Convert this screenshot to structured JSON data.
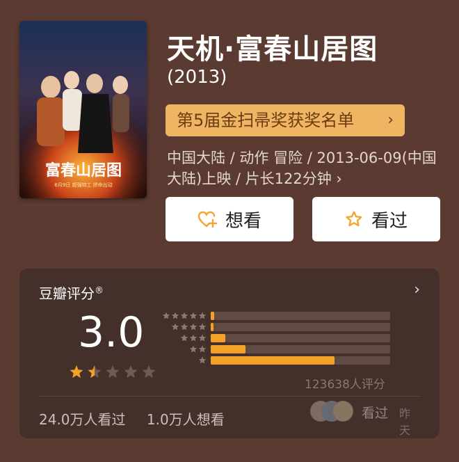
{
  "movie": {
    "title": "天机·富春山居图",
    "year": "(2013)",
    "award": "第5届金扫帚奖获奖名单",
    "meta": "中国大陆 / 动作 冒险 / 2013-06-09(中国大陆)上映 / 片长122分钟 ›",
    "poster": {
      "title": "富春山居图",
      "tagline": "6月9日 超强特工 拼命出动"
    }
  },
  "actions": {
    "want": "想看",
    "seen": "看过"
  },
  "rating": {
    "header": "豆瓣评分",
    "registered": "®",
    "score": "3.0",
    "stars_filled": 1.5,
    "stars_total": 5,
    "distribution": [
      {
        "stars": 5,
        "fraction": 0.02
      },
      {
        "stars": 4,
        "fraction": 0.015
      },
      {
        "stars": 3,
        "fraction": 0.08
      },
      {
        "stars": 2,
        "fraction": 0.195
      },
      {
        "stars": 1,
        "fraction": 0.69
      }
    ],
    "count": "123638人评分",
    "seen_count": "24.0万人看过",
    "want_count": "1.0万人想看",
    "friends_label": "看过",
    "friends_time": "昨天"
  },
  "colors": {
    "background": "#5a3a31",
    "card": "#43302b",
    "accent": "#f4a227",
    "award_bg": "#f0b562"
  }
}
